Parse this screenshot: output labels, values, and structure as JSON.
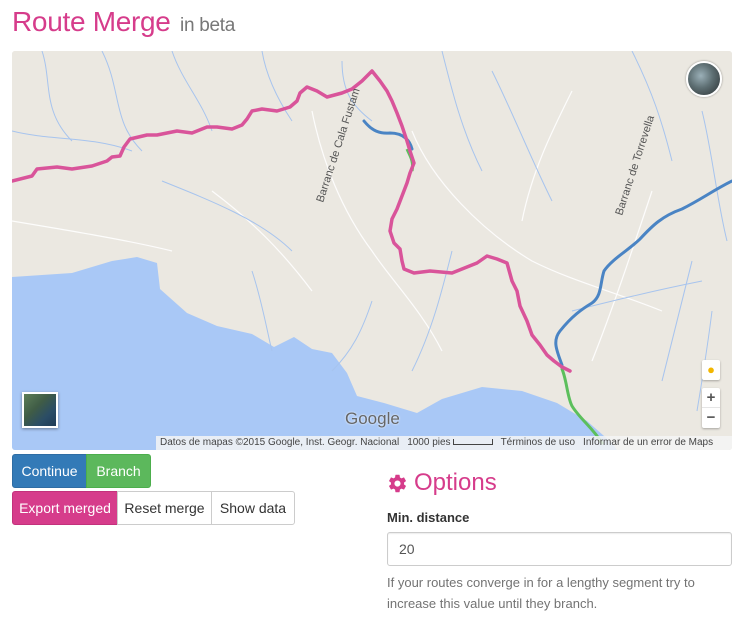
{
  "header": {
    "title": "Route Merge",
    "badge": "in beta"
  },
  "map": {
    "place_labels": [
      "Barranc de Cala Fustam",
      "Barranc de Torrevella"
    ],
    "logo_text": "Google",
    "attribution": "Datos de mapas ©2015 Google, Inst. Geogr. Nacional",
    "scale_text": "1000 pies",
    "terms_text": "Términos de uso",
    "report_text": "Informar de un error de Maps",
    "zoom_in": "+",
    "zoom_out": "−",
    "route_colors": {
      "merged": "#d9549a",
      "route_a": "#4a84c4",
      "route_b": "#5cbf5c"
    }
  },
  "buttons": {
    "continue": "Continue",
    "branch": "Branch",
    "export": "Export merged",
    "reset": "Reset merge",
    "show": "Show data"
  },
  "options": {
    "heading": "Options",
    "heading_icon": "gear-icon",
    "min_distance_label": "Min. distance",
    "min_distance_value": "20",
    "help_text": "If your routes converge in for a lengthy segment try to increase this value until they branch."
  }
}
